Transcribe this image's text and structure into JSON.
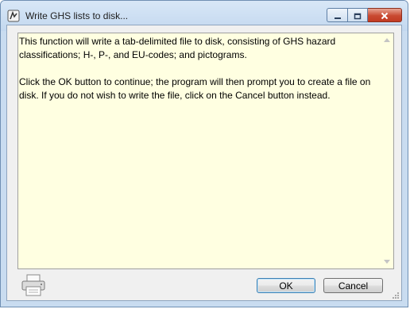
{
  "window": {
    "title": "Write GHS lists to disk..."
  },
  "message": {
    "paragraphs": [
      "This function will write a tab-delimited file to disk, consisting of GHS hazard classifications; H-, P-, and EU-codes; and pictograms.",
      "Click the OK button to continue; the program will then prompt you to create a file on disk. If you do not wish to write the file, click on the Cancel button instead."
    ]
  },
  "buttons": {
    "ok_label": "OK",
    "cancel_label": "Cancel"
  },
  "icons": {
    "app": "app-icon",
    "printer": "printer-icon",
    "minimize": "minimize-icon",
    "maximize": "maximize-icon",
    "close": "close-icon"
  },
  "colors": {
    "text_background": "#ffffe1",
    "close_button": "#c94a31",
    "title_bar": "#c9dcf0"
  }
}
